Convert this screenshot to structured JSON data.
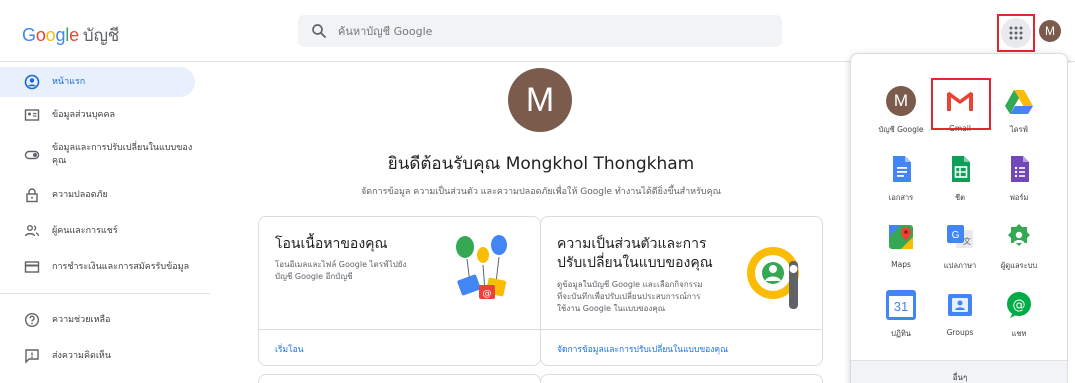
{
  "header": {
    "logo_letters": [
      "G",
      "o",
      "o",
      "g",
      "l",
      "e"
    ],
    "product": "บัญชี",
    "search_placeholder": "ค้นหาบัญชี Google",
    "avatar_letter": "M"
  },
  "sidebar": {
    "items": [
      {
        "label": "หน้าแรก",
        "icon": "account-circle-icon"
      },
      {
        "label": "ข้อมูลส่วนบุคคล",
        "icon": "id-card-icon"
      },
      {
        "label": "ข้อมูลและการปรับเปลี่ยนในแบบของคุณ",
        "icon": "toggle-icon"
      },
      {
        "label": "ความปลอดภัย",
        "icon": "lock-icon"
      },
      {
        "label": "ผู้คนและการแชร์",
        "icon": "people-icon"
      },
      {
        "label": "การชำระเงินและการสมัครรับข้อมูล",
        "icon": "credit-card-icon"
      },
      {
        "label": "ความช่วยเหลือ",
        "icon": "help-icon"
      },
      {
        "label": "ส่งความคิดเห็น",
        "icon": "feedback-icon"
      }
    ]
  },
  "main": {
    "avatar_letter": "M",
    "welcome": "ยินดีต้อนรับคุณ Mongkhol Thongkham",
    "subtext": "จัดการข้อมูล ความเป็นส่วนตัว และความปลอดภัยเพื่อให้ Google ทำงานได้ดียิ่งขึ้นสำหรับคุณ",
    "cards": [
      {
        "title": "โอนเนื้อหาของคุณ",
        "desc_lines": [
          "โอนอีเมลและไฟล์ Google ไดรฟ์ไปยัง",
          "บัญชี Google อีกบัญชี"
        ],
        "link": "เริ่มโอน"
      },
      {
        "title_lines": [
          "ความเป็นส่วนตัวและการ",
          "ปรับเปลี่ยนในแบบของคุณ"
        ],
        "desc_lines": [
          "ดูข้อมูลในบัญชี Google และเลือกกิจกรรม",
          "ที่จะบันทึกเพื่อปรับเปลี่ยนประสบการณ์การ",
          "ใช้งาน Google ในแบบของคุณ"
        ],
        "link": "จัดการข้อมูลและการปรับเปลี่ยนในแบบของคุณ"
      }
    ]
  },
  "apps_panel": {
    "apps": [
      {
        "label": "บัญชี Google",
        "icon": "account-avatar-icon",
        "letter": "M"
      },
      {
        "label": "Gmail",
        "icon": "gmail-icon"
      },
      {
        "label": "ไดรฟ์",
        "icon": "drive-icon"
      },
      {
        "label": "เอกสาร",
        "icon": "docs-icon"
      },
      {
        "label": "ชีต",
        "icon": "sheets-icon"
      },
      {
        "label": "ฟอร์ม",
        "icon": "forms-icon"
      },
      {
        "label": "Maps",
        "icon": "maps-icon"
      },
      {
        "label": "แปลภาษา",
        "icon": "translate-icon"
      },
      {
        "label": "ผู้ดูแลระบบ",
        "icon": "admin-icon"
      },
      {
        "label": "ปฏิทิน",
        "icon": "calendar-icon",
        "day": "31"
      },
      {
        "label": "Groups",
        "icon": "groups-icon"
      },
      {
        "label": "แชท",
        "icon": "chat-icon"
      }
    ],
    "more_label": "อื่นๆ"
  },
  "colors": {
    "accent": "#1a73e8",
    "active_bg": "#e8f0fe",
    "highlight_box": "#e3262f",
    "avatar": "#7a5b4c"
  }
}
